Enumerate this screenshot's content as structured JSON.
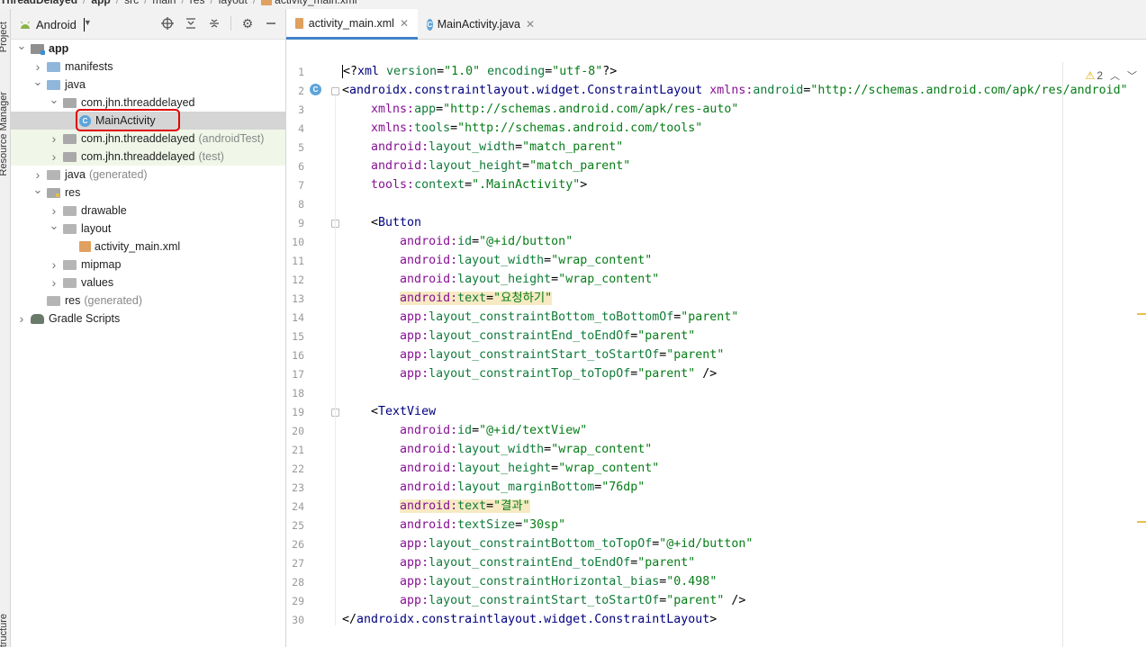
{
  "breadcrumb": [
    "ThreadDelayed",
    "app",
    "src",
    "main",
    "res",
    "layout",
    "activity_main.xml"
  ],
  "tool_strip": {
    "tabs": [
      "Project",
      "Resource Manager",
      "Structure"
    ]
  },
  "project_panel": {
    "view_mode": "Android",
    "tree": [
      {
        "label": "app",
        "suffix": "",
        "icon": "module-icon",
        "depth": 0,
        "arrow": "down",
        "bold": true
      },
      {
        "label": "manifests",
        "suffix": "",
        "icon": "folder-icon",
        "depth": 1,
        "arrow": "right"
      },
      {
        "label": "java",
        "suffix": "",
        "icon": "folder-icon",
        "depth": 1,
        "arrow": "down"
      },
      {
        "label": "com.jhn.threaddelayed",
        "suffix": "",
        "icon": "package-icon",
        "depth": 2,
        "arrow": "down"
      },
      {
        "label": "MainActivity",
        "suffix": "",
        "icon": "class-icon",
        "depth": 3,
        "arrow": "none",
        "selected": true
      },
      {
        "label": "com.jhn.threaddelayed",
        "suffix": "(androidTest)",
        "icon": "package-icon",
        "depth": 2,
        "arrow": "right",
        "test": true
      },
      {
        "label": "com.jhn.threaddelayed",
        "suffix": "(test)",
        "icon": "package-icon",
        "depth": 2,
        "arrow": "right",
        "test": true
      },
      {
        "label": "java",
        "suffix": "(generated)",
        "icon": "generated-folder-icon",
        "depth": 1,
        "arrow": "right"
      },
      {
        "label": "res",
        "suffix": "",
        "icon": "res-folder-icon",
        "depth": 1,
        "arrow": "down"
      },
      {
        "label": "drawable",
        "suffix": "",
        "icon": "folder-icon",
        "depth": 2,
        "arrow": "right"
      },
      {
        "label": "layout",
        "suffix": "",
        "icon": "folder-icon",
        "depth": 2,
        "arrow": "down"
      },
      {
        "label": "activity_main.xml",
        "suffix": "",
        "icon": "xml-file-icon",
        "depth": 3,
        "arrow": "none"
      },
      {
        "label": "mipmap",
        "suffix": "",
        "icon": "folder-icon",
        "depth": 2,
        "arrow": "right"
      },
      {
        "label": "values",
        "suffix": "",
        "icon": "folder-icon",
        "depth": 2,
        "arrow": "right"
      },
      {
        "label": "res",
        "suffix": "(generated)",
        "icon": "generated-folder-icon",
        "depth": 1,
        "arrow": "none"
      },
      {
        "label": "Gradle Scripts",
        "suffix": "",
        "icon": "gradle-icon",
        "depth": 0,
        "arrow": "right"
      }
    ]
  },
  "editor": {
    "tabs": [
      {
        "label": "activity_main.xml",
        "icon": "xml-file-icon",
        "active": true
      },
      {
        "label": "MainActivity.java",
        "icon": "class-icon",
        "active": false
      }
    ],
    "warnings_count": "2",
    "code_lines": [
      [
        [
          "tk-punct",
          "<?"
        ],
        [
          "tk-tag",
          "xml "
        ],
        [
          "tk-attr",
          "version"
        ],
        [
          "tk-punct",
          "="
        ],
        [
          "tk-val",
          "\"1.0\" "
        ],
        [
          "tk-attr",
          "encoding"
        ],
        [
          "tk-punct",
          "="
        ],
        [
          "tk-val",
          "\"utf-8\""
        ],
        [
          "tk-punct",
          "?>"
        ]
      ],
      [
        [
          "tk-punct",
          "<"
        ],
        [
          "tk-tag",
          "androidx.constraintlayout.widget.ConstraintLayout "
        ],
        [
          "tk-ns",
          "xmlns:"
        ],
        [
          "tk-attr",
          "android"
        ],
        [
          "tk-punct",
          "="
        ],
        [
          "tk-val",
          "\"http://schemas.android.com/apk/res/android\""
        ]
      ],
      [
        [
          "tk-punct",
          "    "
        ],
        [
          "tk-ns",
          "xmlns:"
        ],
        [
          "tk-attr",
          "app"
        ],
        [
          "tk-punct",
          "="
        ],
        [
          "tk-val",
          "\"http://schemas.android.com/apk/res-auto\""
        ]
      ],
      [
        [
          "tk-punct",
          "    "
        ],
        [
          "tk-ns",
          "xmlns:"
        ],
        [
          "tk-attr",
          "tools"
        ],
        [
          "tk-punct",
          "="
        ],
        [
          "tk-val",
          "\"http://schemas.android.com/tools\""
        ]
      ],
      [
        [
          "tk-punct",
          "    "
        ],
        [
          "tk-ns",
          "android:"
        ],
        [
          "tk-attr",
          "layout_width"
        ],
        [
          "tk-punct",
          "="
        ],
        [
          "tk-val",
          "\"match_parent\""
        ]
      ],
      [
        [
          "tk-punct",
          "    "
        ],
        [
          "tk-ns",
          "android:"
        ],
        [
          "tk-attr",
          "layout_height"
        ],
        [
          "tk-punct",
          "="
        ],
        [
          "tk-val",
          "\"match_parent\""
        ]
      ],
      [
        [
          "tk-punct",
          "    "
        ],
        [
          "tk-ns",
          "tools:"
        ],
        [
          "tk-attr",
          "context"
        ],
        [
          "tk-punct",
          "="
        ],
        [
          "tk-val",
          "\".MainActivity\""
        ],
        [
          "tk-punct",
          ">"
        ]
      ],
      [
        [
          "tk-punct",
          ""
        ]
      ],
      [
        [
          "tk-punct",
          "    <"
        ],
        [
          "tk-tag",
          "Button"
        ]
      ],
      [
        [
          "tk-punct",
          "        "
        ],
        [
          "tk-ns",
          "android:"
        ],
        [
          "tk-attr",
          "id"
        ],
        [
          "tk-punct",
          "="
        ],
        [
          "tk-val",
          "\"@+id/button\""
        ]
      ],
      [
        [
          "tk-punct",
          "        "
        ],
        [
          "tk-ns",
          "android:"
        ],
        [
          "tk-attr",
          "layout_width"
        ],
        [
          "tk-punct",
          "="
        ],
        [
          "tk-val",
          "\"wrap_content\""
        ]
      ],
      [
        [
          "tk-punct",
          "        "
        ],
        [
          "tk-ns",
          "android:"
        ],
        [
          "tk-attr",
          "layout_height"
        ],
        [
          "tk-punct",
          "="
        ],
        [
          "tk-val",
          "\"wrap_content\""
        ]
      ],
      [
        [
          "tk-punct",
          "        "
        ],
        [
          "tk-ns tk-highlight",
          "android:"
        ],
        [
          "tk-attr tk-highlight",
          "text"
        ],
        [
          "tk-punct tk-highlight",
          "="
        ],
        [
          "tk-val tk-highlight",
          "\"요청하기\""
        ]
      ],
      [
        [
          "tk-punct",
          "        "
        ],
        [
          "tk-ns",
          "app:"
        ],
        [
          "tk-attr",
          "layout_constraintBottom_toBottomOf"
        ],
        [
          "tk-punct",
          "="
        ],
        [
          "tk-val",
          "\"parent\""
        ]
      ],
      [
        [
          "tk-punct",
          "        "
        ],
        [
          "tk-ns",
          "app:"
        ],
        [
          "tk-attr",
          "layout_constraintEnd_toEndOf"
        ],
        [
          "tk-punct",
          "="
        ],
        [
          "tk-val",
          "\"parent\""
        ]
      ],
      [
        [
          "tk-punct",
          "        "
        ],
        [
          "tk-ns",
          "app:"
        ],
        [
          "tk-attr",
          "layout_constraintStart_toStartOf"
        ],
        [
          "tk-punct",
          "="
        ],
        [
          "tk-val",
          "\"parent\""
        ]
      ],
      [
        [
          "tk-punct",
          "        "
        ],
        [
          "tk-ns",
          "app:"
        ],
        [
          "tk-attr",
          "layout_constraintTop_toTopOf"
        ],
        [
          "tk-punct",
          "="
        ],
        [
          "tk-val",
          "\"parent\""
        ],
        [
          "tk-punct",
          " />"
        ]
      ],
      [
        [
          "tk-punct",
          ""
        ]
      ],
      [
        [
          "tk-punct",
          "    <"
        ],
        [
          "tk-tag",
          "TextView"
        ]
      ],
      [
        [
          "tk-punct",
          "        "
        ],
        [
          "tk-ns",
          "android:"
        ],
        [
          "tk-attr",
          "id"
        ],
        [
          "tk-punct",
          "="
        ],
        [
          "tk-val",
          "\"@+id/textView\""
        ]
      ],
      [
        [
          "tk-punct",
          "        "
        ],
        [
          "tk-ns",
          "android:"
        ],
        [
          "tk-attr",
          "layout_width"
        ],
        [
          "tk-punct",
          "="
        ],
        [
          "tk-val",
          "\"wrap_content\""
        ]
      ],
      [
        [
          "tk-punct",
          "        "
        ],
        [
          "tk-ns",
          "android:"
        ],
        [
          "tk-attr",
          "layout_height"
        ],
        [
          "tk-punct",
          "="
        ],
        [
          "tk-val",
          "\"wrap_content\""
        ]
      ],
      [
        [
          "tk-punct",
          "        "
        ],
        [
          "tk-ns",
          "android:"
        ],
        [
          "tk-attr",
          "layout_marginBottom"
        ],
        [
          "tk-punct",
          "="
        ],
        [
          "tk-val",
          "\"76dp\""
        ]
      ],
      [
        [
          "tk-punct",
          "        "
        ],
        [
          "tk-ns tk-highlight",
          "android:"
        ],
        [
          "tk-attr tk-highlight",
          "text"
        ],
        [
          "tk-punct tk-highlight",
          "="
        ],
        [
          "tk-val tk-highlight",
          "\"결과\""
        ]
      ],
      [
        [
          "tk-punct",
          "        "
        ],
        [
          "tk-ns",
          "android:"
        ],
        [
          "tk-attr",
          "textSize"
        ],
        [
          "tk-punct",
          "="
        ],
        [
          "tk-val",
          "\"30sp\""
        ]
      ],
      [
        [
          "tk-punct",
          "        "
        ],
        [
          "tk-ns",
          "app:"
        ],
        [
          "tk-attr",
          "layout_constraintBottom_toTopOf"
        ],
        [
          "tk-punct",
          "="
        ],
        [
          "tk-val",
          "\"@+id/button\""
        ]
      ],
      [
        [
          "tk-punct",
          "        "
        ],
        [
          "tk-ns",
          "app:"
        ],
        [
          "tk-attr",
          "layout_constraintEnd_toEndOf"
        ],
        [
          "tk-punct",
          "="
        ],
        [
          "tk-val",
          "\"parent\""
        ]
      ],
      [
        [
          "tk-punct",
          "        "
        ],
        [
          "tk-ns",
          "app:"
        ],
        [
          "tk-attr",
          "layout_constraintHorizontal_bias"
        ],
        [
          "tk-punct",
          "="
        ],
        [
          "tk-val",
          "\"0.498\""
        ]
      ],
      [
        [
          "tk-punct",
          "        "
        ],
        [
          "tk-ns",
          "app:"
        ],
        [
          "tk-attr",
          "layout_constraintStart_toStartOf"
        ],
        [
          "tk-punct",
          "="
        ],
        [
          "tk-val",
          "\"parent\""
        ],
        [
          "tk-punct",
          " />"
        ]
      ],
      [
        [
          "tk-punct",
          "</"
        ],
        [
          "tk-tag",
          "androidx.constraintlayout.widget.ConstraintLayout"
        ],
        [
          "tk-punct",
          ">"
        ]
      ]
    ]
  }
}
